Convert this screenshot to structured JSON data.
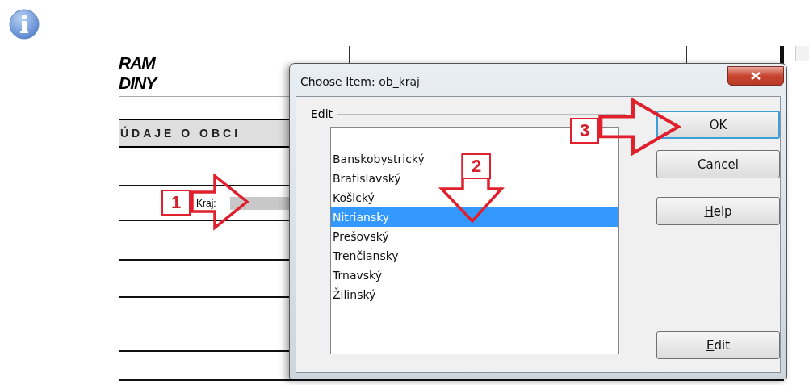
{
  "document": {
    "heading_lines": [
      "RAM",
      "DINY"
    ],
    "section_title": "ÚDAJE O OBCI",
    "field_label": "Kraj:"
  },
  "dialog": {
    "title": "Choose Item: ob_kraj",
    "group_label": "Edit",
    "items": [
      {
        "label": "Banskobystrický",
        "selected": false
      },
      {
        "label": "Bratislavský",
        "selected": false
      },
      {
        "label": "Košický",
        "selected": false
      },
      {
        "label": "Nitriansky",
        "selected": true
      },
      {
        "label": "Prešovský",
        "selected": false
      },
      {
        "label": "Trenčiansky",
        "selected": false
      },
      {
        "label": "Trnavský",
        "selected": false
      },
      {
        "label": "Žilinský",
        "selected": false
      }
    ],
    "buttons": [
      {
        "label": "OK",
        "default": true,
        "underline_first": false,
        "kind": "top"
      },
      {
        "label": "Cancel",
        "default": false,
        "underline_first": false,
        "kind": "top"
      },
      {
        "label": "Help",
        "default": false,
        "underline_first": true,
        "kind": "top"
      },
      {
        "label": "Edit",
        "default": false,
        "underline_first": true,
        "kind": "bottom"
      }
    ]
  },
  "annotations": [
    {
      "number": "1",
      "kind": "right"
    },
    {
      "number": "2",
      "kind": "down"
    },
    {
      "number": "3",
      "kind": "right"
    }
  ]
}
